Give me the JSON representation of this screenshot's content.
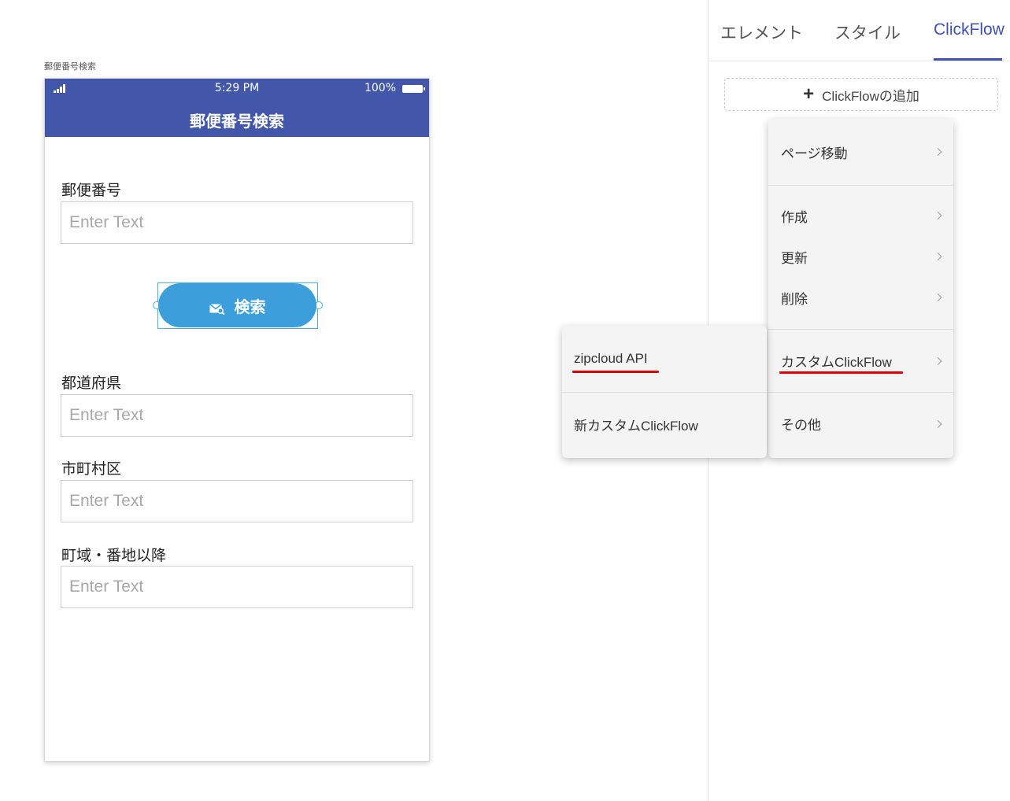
{
  "preview": {
    "page_name": "郵便番号検索",
    "status": {
      "time": "5:29 PM",
      "battery": "100%"
    },
    "title": "郵便番号検索",
    "fields": [
      {
        "label": "郵便番号",
        "placeholder": "Enter Text"
      },
      {
        "label": "都道府県",
        "placeholder": "Enter Text"
      },
      {
        "label": "市町村区",
        "placeholder": "Enter Text"
      },
      {
        "label": "町域・番地以降",
        "placeholder": "Enter Text"
      }
    ],
    "search_button": {
      "label": "検索",
      "color": "#3c9fdb"
    },
    "header_color": "#4257a9"
  },
  "panel": {
    "tabs": [
      {
        "label": "エレメント",
        "active": false
      },
      {
        "label": "スタイル",
        "active": false
      },
      {
        "label": "ClickFlow",
        "active": true
      }
    ],
    "add_button": "ClickFlowの追加",
    "accent_color": "#3f51b5"
  },
  "menu": {
    "items": [
      {
        "label": "ページ移動"
      },
      {
        "label": "作成"
      },
      {
        "label": "更新"
      },
      {
        "label": "削除"
      },
      {
        "label": "カスタムClickFlow",
        "highlighted": true
      },
      {
        "label": "その他"
      }
    ],
    "submenu": [
      {
        "label": "zipcloud API",
        "highlighted": true
      },
      {
        "label": "新カスタムClickFlow"
      }
    ],
    "highlight_color": "#e00000"
  }
}
